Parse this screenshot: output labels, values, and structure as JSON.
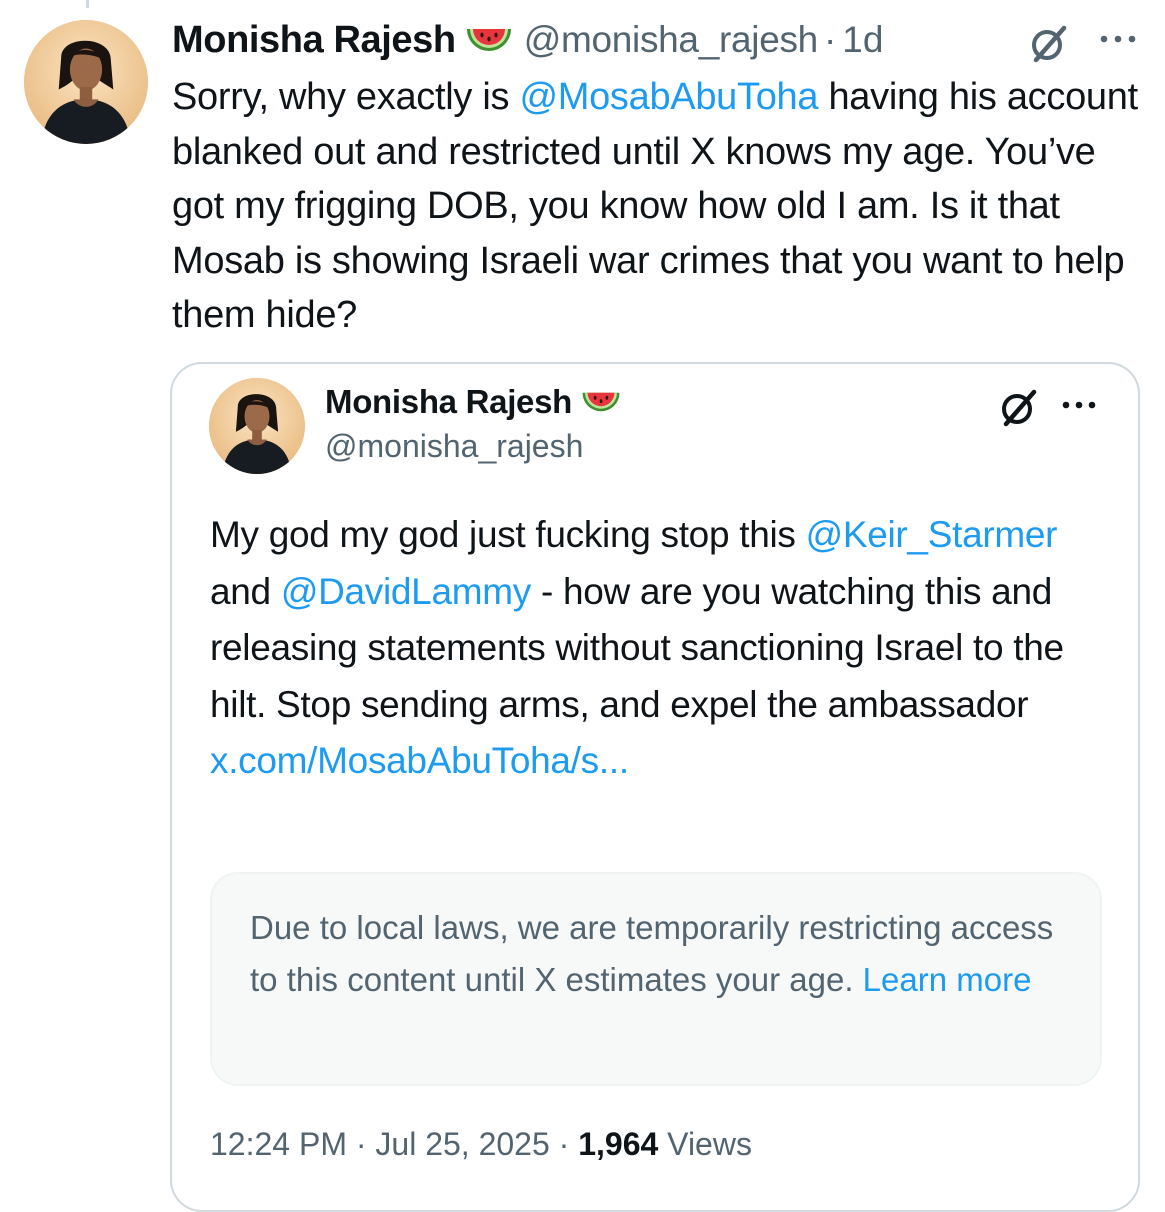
{
  "tweet": {
    "display_name": "Monisha Rajesh",
    "handle": "@monisha_rajesh",
    "separator": "·",
    "time": "1d",
    "text_1": "Sorry, why exactly is ",
    "mention": "@MosabAbuToha",
    "text_2": " having his account blanked out and restricted until X knows my age. You’ve got my frigging DOB, you know how old I am. Is it that Mosab is showing Israeli war crimes that you want to help them hide?"
  },
  "quoted_tweet": {
    "display_name": "Monisha Rajesh",
    "handle": "@monisha_rajesh",
    "text_1": "My god my god just fucking stop this ",
    "mention_1": "@Keir_Starmer",
    "text_2": " and ",
    "mention_2": "@DavidLammy",
    "text_3": " - how are you watching this and releasing statements without sanctioning Israel to the hilt. Stop sending arms, and expel the ambassador ",
    "link": "x.com/MosabAbuToha/s...",
    "notice": {
      "text": "Due to local laws, we are temporarily restricting access to this content until X estimates your age. ",
      "learn_more": "Learn more"
    },
    "meta": {
      "time": "12:24 PM",
      "sep_1": "·",
      "date": "Jul 25, 2025",
      "sep_2": "·",
      "views_count": "1,964",
      "views_label": "Views"
    }
  },
  "icons": {
    "emoji": "watermelon-emoji",
    "grok": "grok-icon",
    "more": "more-icon"
  },
  "colors": {
    "link": "#1d9bf0",
    "secondary_text": "#536471",
    "primary_text": "#0f1419",
    "border": "#cfd9de"
  }
}
